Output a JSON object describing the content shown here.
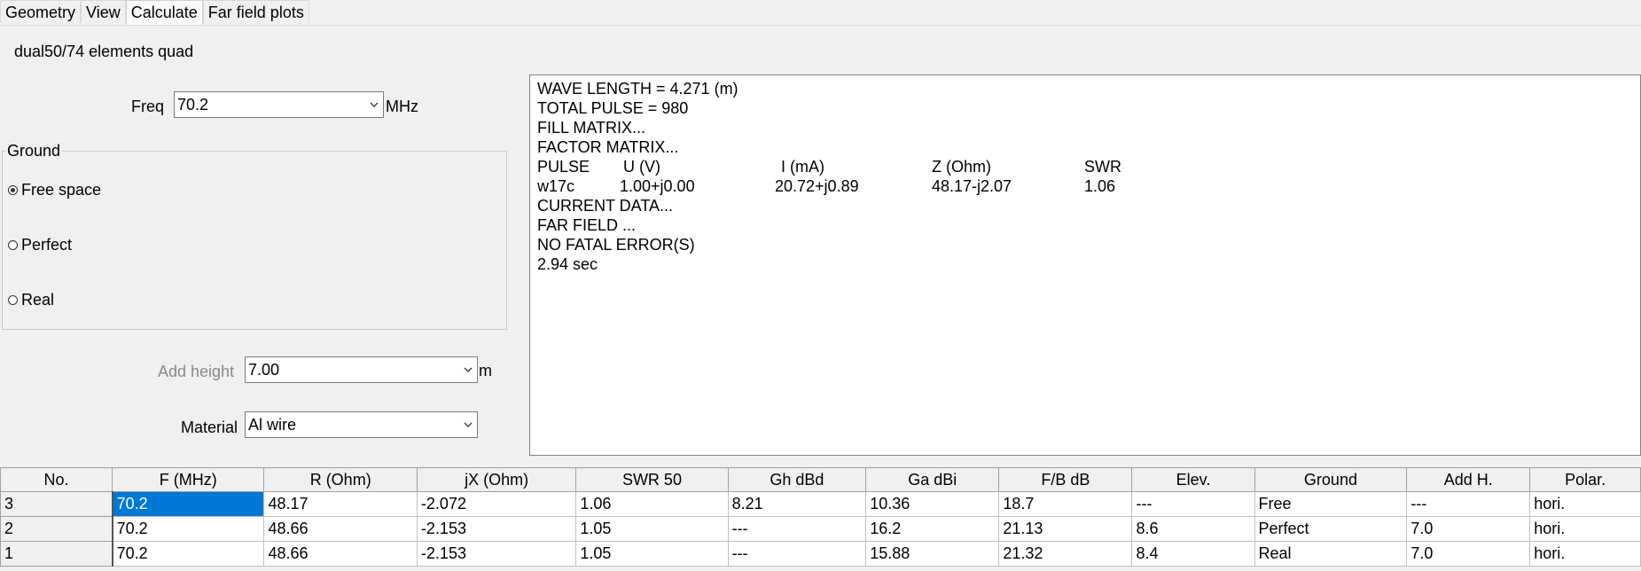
{
  "tabs": [
    "Geometry",
    "View",
    "Calculate",
    "Far field plots"
  ],
  "active_tab": "Calculate",
  "title": "dual50/74 elements quad",
  "freq": {
    "label": "Freq",
    "value": "70.2",
    "unit": "MHz"
  },
  "ground": {
    "legend": "Ground",
    "options": [
      "Free space",
      "Perfect",
      "Real"
    ],
    "selected": "Free space"
  },
  "add_height": {
    "label": "Add height",
    "value": "7.00",
    "unit": "m"
  },
  "material": {
    "label": "Material",
    "value": "Al wire"
  },
  "output": {
    "lines": [
      "WAVE LENGTH = 4.271 (m)",
      "TOTAL PULSE = 980",
      "FILL MATRIX...",
      "FACTOR MATRIX..."
    ],
    "header": [
      "PULSE",
      "U (V)",
      "I (mA)",
      "Z (Ohm)",
      "SWR"
    ],
    "data": [
      "w17c",
      "1.00+j0.00",
      "20.72+j0.89",
      "48.17-j2.07",
      "1.06"
    ],
    "tail": [
      "CURRENT DATA...",
      "FAR FIELD ...",
      "NO FATAL ERROR(S)",
      "2.94 sec"
    ]
  },
  "table": {
    "columns": [
      "No.",
      "F (MHz)",
      "R (Ohm)",
      "jX (Ohm)",
      "SWR 50",
      "Gh dBd",
      "Ga dBi",
      "F/B dB",
      "Elev.",
      "Ground",
      "Add H.",
      "Polar."
    ],
    "rows": [
      [
        "3",
        "70.2",
        "48.17",
        "-2.072",
        "1.06",
        "8.21",
        "10.36",
        "18.7",
        " ---",
        "Free",
        " ---",
        "hori."
      ],
      [
        "2",
        "70.2",
        "48.66",
        "-2.153",
        "1.05",
        "---",
        "16.2",
        "21.13",
        "8.6",
        "Perfect",
        "7.0",
        "hori."
      ],
      [
        "1",
        "70.2",
        "48.66",
        "-2.153",
        "1.05",
        "---",
        "15.88",
        "21.32",
        "8.4",
        "Real",
        "7.0",
        "hori."
      ]
    ]
  }
}
